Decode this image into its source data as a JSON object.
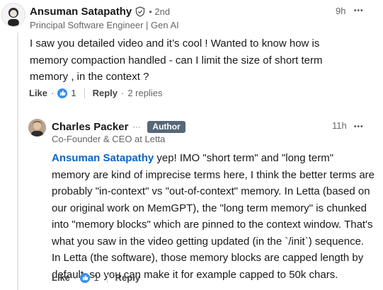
{
  "comment1": {
    "author": "Ansuman Satapathy",
    "degree": "• 2nd",
    "headline": "Principal Software Engineer | Gen AI",
    "time": "9h",
    "text": "I saw you detailed video and it’s cool ! Wanted to know how is memory compaction handled - can I limit the size of short term memory , in the context ?",
    "actions": {
      "like": "Like",
      "dot": "·",
      "like_count": "1",
      "reply": "Reply",
      "replies": "2 replies"
    }
  },
  "comment2": {
    "author": "Charles Packer",
    "ellipsis": "···",
    "badge": "Author",
    "headline": "Co-Founder & CEO at Letta",
    "time": "11h",
    "mention": "Ansuman Satapathy",
    "text": " yep! IMO \"short term\" and \"long term\" memory are kind of imprecise terms here, I think the better terms are probably \"in-context\" vs \"out-of-context\" memory. In Letta (based on our original work on MemGPT), the \"long term memory\" is chunked into \"memory blocks\" which are pinned to the context window. That's what you saw in the video getting updated (in the `/init`) sequence. In Letta (the software), those memory blocks are capped length by default, so you can make it for example capped to 50k chars.",
    "actions": {
      "like": "Like",
      "dot": "·",
      "like_count": "1",
      "reply": "Reply"
    }
  },
  "more_menu_glyph": "•••"
}
